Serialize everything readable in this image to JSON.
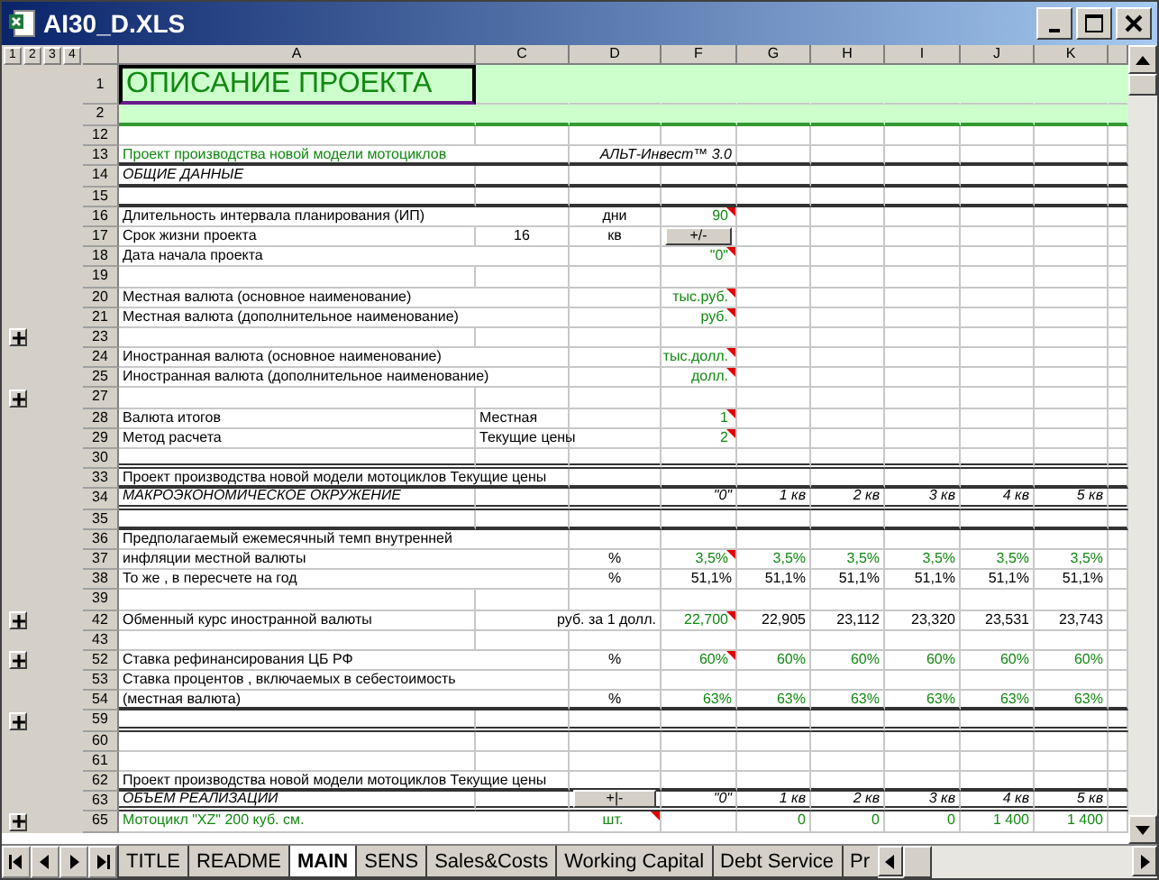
{
  "window": {
    "title": "AI30_D.XLS"
  },
  "outline_levels": [
    "1",
    "2",
    "3",
    "4"
  ],
  "columns": [
    "A",
    "C",
    "D",
    "F",
    "G",
    "H",
    "I",
    "J",
    "K"
  ],
  "rows": [
    {
      "number": "1",
      "kind": "title",
      "group_toggle": false,
      "cells": [
        {
          "kind": "title",
          "text": "ОПИСАНИЕ ПРОЕКТА",
          "input": true,
          "comment": false
        }
      ]
    },
    {
      "number": "2",
      "kind": "subtitle",
      "group_toggle": false,
      "cells": []
    },
    {
      "number": "12",
      "kind": "plain",
      "group_toggle": false,
      "cells": []
    },
    {
      "number": "13",
      "kind": "thick",
      "group_toggle": false,
      "cells": [
        {
          "kind": "label",
          "text": "Проект производства новой модели мотоциклов",
          "input": true,
          "comment": false
        },
        null,
        null,
        {
          "kind": "brand",
          "text": "АЛЬТ-Инвест™ 3.0",
          "input": false,
          "comment": false
        }
      ]
    },
    {
      "number": "14",
      "kind": "thick",
      "group_toggle": false,
      "cells": [
        {
          "kind": "heading",
          "text": "ОБЩИЕ ДАННЫЕ",
          "input": false,
          "comment": false
        }
      ]
    },
    {
      "number": "15",
      "kind": "thick",
      "group_toggle": false,
      "cells": []
    },
    {
      "number": "16",
      "kind": "plain",
      "group_toggle": false,
      "cells": [
        {
          "kind": "label",
          "text": "Длительность интервала планирования (ИП)",
          "input": false,
          "comment": false
        },
        null,
        {
          "kind": "unit",
          "text": "дни",
          "input": false,
          "comment": false
        },
        {
          "kind": "value",
          "text": "90",
          "input": true,
          "comment": true
        }
      ]
    },
    {
      "number": "17",
      "kind": "plain",
      "group_toggle": false,
      "cells": [
        {
          "kind": "label",
          "text": "Срок жизни проекта",
          "input": false,
          "comment": false
        },
        {
          "kind": "unit",
          "text": "16",
          "input": false,
          "comment": false
        },
        {
          "kind": "unit",
          "text": "кв",
          "input": false,
          "comment": false
        },
        {
          "kind": "button",
          "text": "+/-"
        }
      ]
    },
    {
      "number": "18",
      "kind": "plain",
      "group_toggle": false,
      "cells": [
        {
          "kind": "label",
          "text": "Дата начала проекта",
          "input": false,
          "comment": false
        },
        null,
        null,
        {
          "kind": "value",
          "text": "\"0\"",
          "input": true,
          "comment": true
        }
      ]
    },
    {
      "number": "19",
      "kind": "plain",
      "group_toggle": false,
      "cells": []
    },
    {
      "number": "20",
      "kind": "plain",
      "group_toggle": false,
      "cells": [
        {
          "kind": "label",
          "text": "Местная валюта (основное наименование)",
          "input": false,
          "comment": false
        },
        null,
        null,
        {
          "kind": "value",
          "text": "тыс.руб.",
          "input": true,
          "comment": true
        }
      ]
    },
    {
      "number": "21",
      "kind": "plain",
      "group_toggle": false,
      "cells": [
        {
          "kind": "label",
          "text": "Местная валюта (дополнительное наименование)",
          "input": false,
          "comment": false
        },
        null,
        null,
        {
          "kind": "value",
          "text": "руб.",
          "input": true,
          "comment": true
        }
      ]
    },
    {
      "number": "23",
      "kind": "plain",
      "group_toggle": true,
      "cells": []
    },
    {
      "number": "24",
      "kind": "plain",
      "group_toggle": false,
      "cells": [
        {
          "kind": "label",
          "text": "Иностранная валюта  (основное наименование)",
          "input": false,
          "comment": false
        },
        null,
        null,
        {
          "kind": "value",
          "text": "тыс.долл.",
          "input": true,
          "comment": true
        }
      ]
    },
    {
      "number": "25",
      "kind": "plain",
      "group_toggle": false,
      "cells": [
        {
          "kind": "label",
          "text": "Иностранная валюта (дополнительное наименование)",
          "input": false,
          "comment": false
        },
        null,
        null,
        {
          "kind": "value",
          "text": "долл.",
          "input": true,
          "comment": true
        }
      ]
    },
    {
      "number": "27",
      "kind": "plain",
      "group_toggle": true,
      "cells": []
    },
    {
      "number": "28",
      "kind": "plain",
      "group_toggle": false,
      "cells": [
        {
          "kind": "label",
          "text": "Валюта итогов",
          "input": false,
          "comment": false
        },
        {
          "kind": "label",
          "text": "Местная",
          "input": false,
          "comment": false
        },
        null,
        {
          "kind": "value",
          "text": "1",
          "input": true,
          "comment": true
        }
      ]
    },
    {
      "number": "29",
      "kind": "plain",
      "group_toggle": false,
      "cells": [
        {
          "kind": "label",
          "text": "Метод расчета",
          "input": false,
          "comment": false
        },
        {
          "kind": "label",
          "text": "Текущие цены",
          "input": false,
          "comment": false
        },
        null,
        {
          "kind": "value",
          "text": "2",
          "input": true,
          "comment": true
        }
      ]
    },
    {
      "number": "30",
      "kind": "double",
      "group_toggle": false,
      "cells": []
    },
    {
      "number": "33",
      "kind": "thick",
      "group_toggle": false,
      "cells": [
        {
          "kind": "label",
          "text": "Проект производства новой модели мотоциклов  Текущие цены",
          "input": false,
          "comment": false
        }
      ]
    },
    {
      "number": "34",
      "kind": "double",
      "group_toggle": false,
      "cells": [
        {
          "kind": "heading",
          "text": "МАКРОЭКОНОМИЧЕСКОЕ ОКРУЖЕНИЕ",
          "input": false,
          "comment": false
        },
        null,
        null,
        {
          "kind": "period",
          "text": "\"0\"",
          "input": false,
          "comment": false
        },
        {
          "kind": "period",
          "text": "1 кв",
          "input": false,
          "comment": false
        },
        {
          "kind": "period",
          "text": "2 кв",
          "input": false,
          "comment": false
        },
        {
          "kind": "period",
          "text": "3 кв",
          "input": false,
          "comment": false
        },
        {
          "kind": "period",
          "text": "4 кв",
          "input": false,
          "comment": false
        },
        {
          "kind": "period",
          "text": "5 кв",
          "input": false,
          "comment": false
        }
      ]
    },
    {
      "number": "35",
      "kind": "thick",
      "group_toggle": false,
      "cells": []
    },
    {
      "number": "36",
      "kind": "plain",
      "group_toggle": false,
      "cells": [
        {
          "kind": "label",
          "text": "Предполагаемый ежемесячный темп внутренней",
          "input": false,
          "comment": false
        }
      ]
    },
    {
      "number": "37",
      "kind": "plain",
      "group_toggle": false,
      "cells": [
        {
          "kind": "label",
          "text": " инфляции местной валюты",
          "input": false,
          "comment": false
        },
        null,
        {
          "kind": "unit",
          "text": "%",
          "input": false,
          "comment": false
        },
        {
          "kind": "value",
          "text": "3,5%",
          "input": true,
          "comment": true
        },
        {
          "kind": "value",
          "text": "3,5%",
          "input": true,
          "comment": false
        },
        {
          "kind": "value",
          "text": "3,5%",
          "input": true,
          "comment": false
        },
        {
          "kind": "value",
          "text": "3,5%",
          "input": true,
          "comment": false
        },
        {
          "kind": "value",
          "text": "3,5%",
          "input": true,
          "comment": false
        },
        {
          "kind": "value",
          "text": "3,5%",
          "input": true,
          "comment": false
        }
      ]
    },
    {
      "number": "38",
      "kind": "plain",
      "group_toggle": false,
      "cells": [
        {
          "kind": "label",
          "text": "То же , в пересчете на год",
          "input": false,
          "comment": false
        },
        null,
        {
          "kind": "unit",
          "text": "%",
          "input": false,
          "comment": false
        },
        {
          "kind": "value",
          "text": "51,1%",
          "input": false,
          "comment": false
        },
        {
          "kind": "value",
          "text": "51,1%",
          "input": false,
          "comment": false
        },
        {
          "kind": "value",
          "text": "51,1%",
          "input": false,
          "comment": false
        },
        {
          "kind": "value",
          "text": "51,1%",
          "input": false,
          "comment": false
        },
        {
          "kind": "value",
          "text": "51,1%",
          "input": false,
          "comment": false
        },
        {
          "kind": "value",
          "text": "51,1%",
          "input": false,
          "comment": false
        }
      ]
    },
    {
      "number": "39",
      "kind": "plain",
      "group_toggle": false,
      "cells": []
    },
    {
      "number": "42",
      "kind": "plain",
      "group_toggle": true,
      "cells": [
        {
          "kind": "label",
          "text": "Обменный курс иностранной валюты",
          "input": false,
          "comment": false
        },
        null,
        {
          "kind": "note",
          "text": "руб. за 1 долл.",
          "input": false,
          "comment": false
        },
        {
          "kind": "value",
          "text": "22,700",
          "input": true,
          "comment": true
        },
        {
          "kind": "value",
          "text": "22,905",
          "input": false,
          "comment": false
        },
        {
          "kind": "value",
          "text": "23,112",
          "input": false,
          "comment": false
        },
        {
          "kind": "value",
          "text": "23,320",
          "input": false,
          "comment": false
        },
        {
          "kind": "value",
          "text": "23,531",
          "input": false,
          "comment": false
        },
        {
          "kind": "value",
          "text": "23,743",
          "input": false,
          "comment": false
        }
      ]
    },
    {
      "number": "43",
      "kind": "plain",
      "group_toggle": false,
      "cells": []
    },
    {
      "number": "52",
      "kind": "plain",
      "group_toggle": true,
      "cells": [
        {
          "kind": "label",
          "text": "Ставка рефинансирования ЦБ РФ",
          "input": false,
          "comment": false
        },
        null,
        {
          "kind": "unit",
          "text": "%",
          "input": false,
          "comment": false
        },
        {
          "kind": "value",
          "text": "60%",
          "input": true,
          "comment": true
        },
        {
          "kind": "value",
          "text": "60%",
          "input": true,
          "comment": false
        },
        {
          "kind": "value",
          "text": "60%",
          "input": true,
          "comment": false
        },
        {
          "kind": "value",
          "text": "60%",
          "input": true,
          "comment": false
        },
        {
          "kind": "value",
          "text": "60%",
          "input": true,
          "comment": false
        },
        {
          "kind": "value",
          "text": "60%",
          "input": true,
          "comment": false
        }
      ]
    },
    {
      "number": "53",
      "kind": "plain",
      "group_toggle": false,
      "cells": [
        {
          "kind": "label",
          "text": "Ставка процентов , включаемых в себестоимость",
          "input": false,
          "comment": false
        }
      ]
    },
    {
      "number": "54",
      "kind": "thick",
      "group_toggle": false,
      "cells": [
        {
          "kind": "label",
          "text": " (местная валюта)",
          "input": false,
          "comment": false
        },
        null,
        {
          "kind": "unit",
          "text": "%",
          "input": false,
          "comment": false
        },
        {
          "kind": "value",
          "text": "63%",
          "input": true,
          "comment": false
        },
        {
          "kind": "value",
          "text": "63%",
          "input": true,
          "comment": false
        },
        {
          "kind": "value",
          "text": "63%",
          "input": true,
          "comment": false
        },
        {
          "kind": "value",
          "text": "63%",
          "input": true,
          "comment": false
        },
        {
          "kind": "value",
          "text": "63%",
          "input": true,
          "comment": false
        },
        {
          "kind": "value",
          "text": "63%",
          "input": true,
          "comment": false
        }
      ]
    },
    {
      "number": "59",
      "kind": "double",
      "group_toggle": true,
      "cells": []
    },
    {
      "number": "60",
      "kind": "plain",
      "group_toggle": false,
      "cells": []
    },
    {
      "number": "61",
      "kind": "plain",
      "group_toggle": false,
      "cells": []
    },
    {
      "number": "62",
      "kind": "thick",
      "group_toggle": false,
      "cells": [
        {
          "kind": "label",
          "text": "Проект производства новой модели мотоциклов  Текущие цены",
          "input": false,
          "comment": false
        }
      ]
    },
    {
      "number": "63",
      "kind": "double",
      "group_toggle": false,
      "cells": [
        {
          "kind": "heading",
          "text": "ОБЪЕМ РЕАЛИЗАЦИИ",
          "input": false,
          "comment": false
        },
        null,
        {
          "kind": "button",
          "text": "+|-"
        },
        {
          "kind": "period",
          "text": "\"0\"",
          "input": false,
          "comment": false
        },
        {
          "kind": "period",
          "text": "1 кв",
          "input": false,
          "comment": false
        },
        {
          "kind": "period",
          "text": "2 кв",
          "input": false,
          "comment": false
        },
        {
          "kind": "period",
          "text": "3 кв",
          "input": false,
          "comment": false
        },
        {
          "kind": "period",
          "text": "4 кв",
          "input": false,
          "comment": false
        },
        {
          "kind": "period",
          "text": "5 кв",
          "input": false,
          "comment": false
        }
      ]
    },
    {
      "number": "65",
      "kind": "plain",
      "group_toggle": true,
      "cells": [
        {
          "kind": "label",
          "text": "Мотоцикл \"XZ\" 200 куб. см.",
          "input": true,
          "comment": false
        },
        null,
        {
          "kind": "unit",
          "text": "шт.",
          "input": true,
          "comment": true
        },
        null,
        {
          "kind": "value",
          "text": "0",
          "input": true,
          "comment": false
        },
        {
          "kind": "value",
          "text": "0",
          "input": true,
          "comment": false
        },
        {
          "kind": "value",
          "text": "0",
          "input": true,
          "comment": false
        },
        {
          "kind": "value",
          "text": "1 400",
          "input": true,
          "comment": false
        },
        {
          "kind": "value",
          "text": "1 400",
          "input": true,
          "comment": false
        }
      ]
    }
  ],
  "sheet_tabs": [
    {
      "label": "TITLE",
      "selected": false
    },
    {
      "label": "README",
      "selected": false
    },
    {
      "label": "MAIN",
      "selected": true
    },
    {
      "label": "SENS",
      "selected": false
    },
    {
      "label": "Sales&Costs",
      "selected": false
    },
    {
      "label": "Working Capital",
      "selected": false
    },
    {
      "label": "Debt Service",
      "selected": false
    },
    {
      "label": "Pr",
      "selected": false
    }
  ]
}
